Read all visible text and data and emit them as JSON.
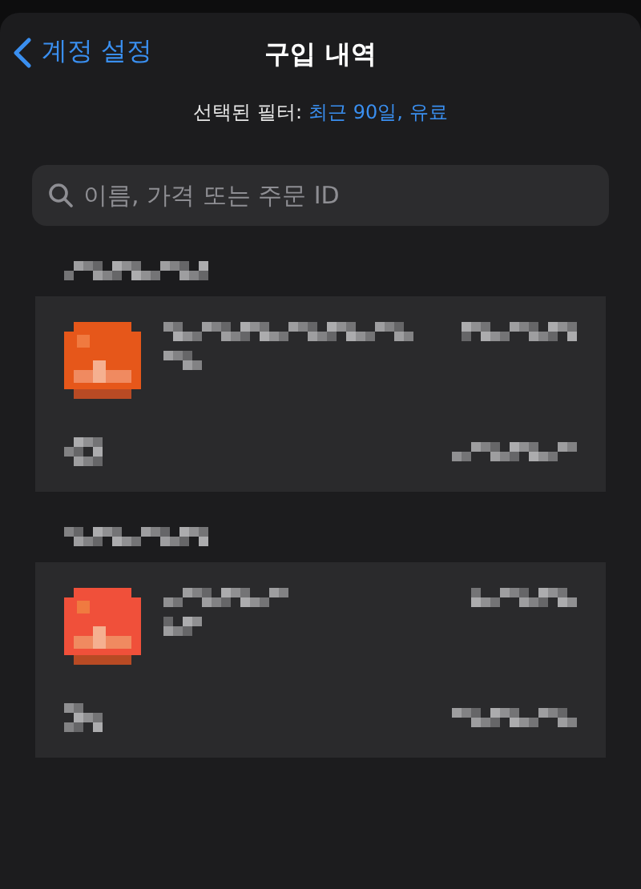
{
  "nav": {
    "back": "계정 설정",
    "title": "구입 내역"
  },
  "filter": {
    "label": "선택된 필터:",
    "value": "최근 90일, 유료"
  },
  "search": {
    "placeholder": "이름, 가격 또는 주문 ID"
  },
  "groups": [
    {
      "kind": "redacted"
    },
    {
      "kind": "redacted"
    }
  ]
}
